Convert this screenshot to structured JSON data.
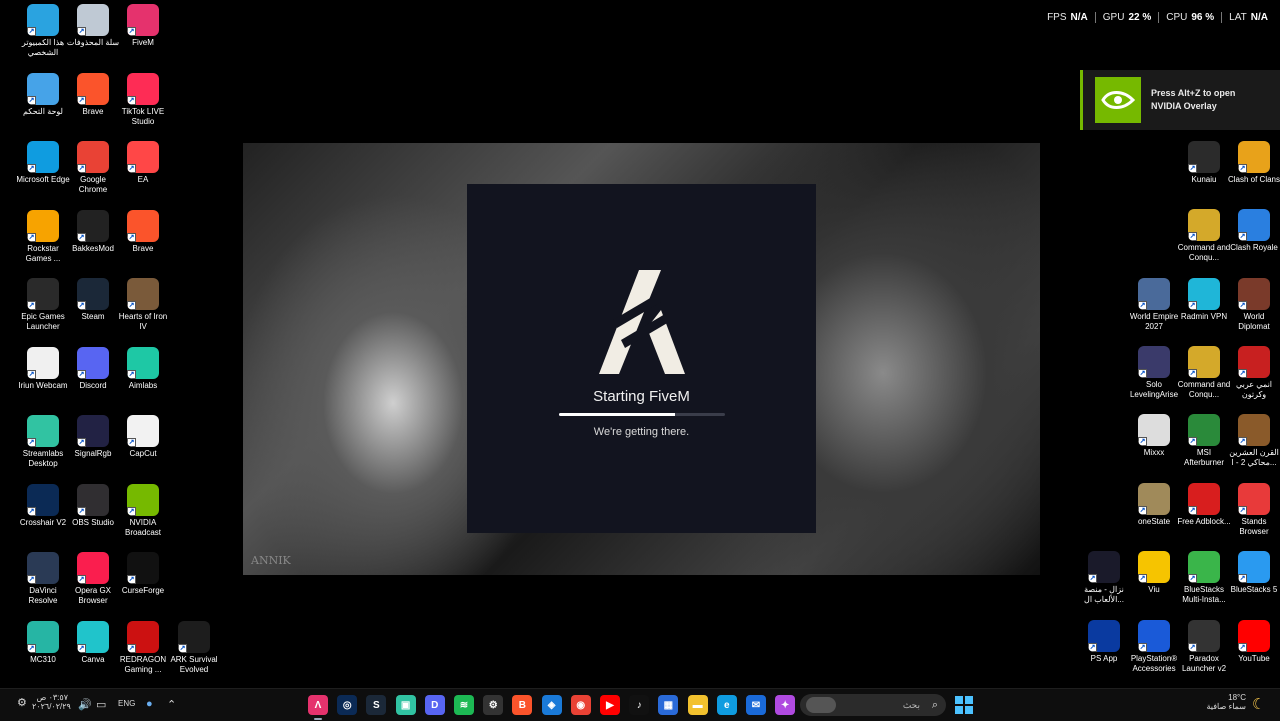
{
  "desktop_left": [
    {
      "label": "هذا الكمبيوتر الشخصي",
      "icon": "monitor-icon",
      "color": "#2aa3e0"
    },
    {
      "label": "سلة المحذوفات",
      "icon": "recycle-bin-icon",
      "color": "#bfc9d4"
    },
    {
      "label": "FiveM",
      "icon": "fivem-icon",
      "color": "#e5326d"
    },
    {
      "label": "لوحة التحكم",
      "icon": "control-panel-icon",
      "color": "#46a3e8"
    },
    {
      "label": "Brave",
      "icon": "brave-icon",
      "color": "#fb542b"
    },
    {
      "label": "TikTok LIVE Studio",
      "icon": "tiktok-icon",
      "color": "#fe2c55"
    },
    {
      "label": "Microsoft Edge",
      "icon": "edge-icon",
      "color": "#0f9ce0"
    },
    {
      "label": "Google Chrome",
      "icon": "chrome-icon",
      "color": "#e94235"
    },
    {
      "label": "EA",
      "icon": "ea-icon",
      "color": "#ff4747"
    },
    {
      "label": "Rockstar Games ...",
      "icon": "rockstar-icon",
      "color": "#f7a300"
    },
    {
      "label": "BakkesMod",
      "icon": "bakkesmod-icon",
      "color": "#222222"
    },
    {
      "label": "Brave",
      "icon": "brave-icon",
      "color": "#fb542b"
    },
    {
      "label": "Epic Games Launcher",
      "icon": "epic-games-icon",
      "color": "#2a2a2a"
    },
    {
      "label": "Steam",
      "icon": "steam-icon",
      "color": "#1b2838"
    },
    {
      "label": "Hearts of Iron IV",
      "icon": "hoi4-icon",
      "color": "#7a5a3a"
    },
    {
      "label": "Iriun Webcam",
      "icon": "webcam-icon",
      "color": "#f0f0f0"
    },
    {
      "label": "Discord",
      "icon": "discord-icon",
      "color": "#5865f2"
    },
    {
      "label": "Aimlabs",
      "icon": "aimlabs-icon",
      "color": "#1ec8a5"
    },
    {
      "label": "Streamlabs Desktop",
      "icon": "streamlabs-icon",
      "color": "#31c3a2"
    },
    {
      "label": "SignalRgb",
      "icon": "signalrgb-icon",
      "color": "#222244"
    },
    {
      "label": "CapCut",
      "icon": "capcut-icon",
      "color": "#f2f2f2"
    },
    {
      "label": "Crosshair V2",
      "icon": "crosshair-icon",
      "color": "#0b2a55"
    },
    {
      "label": "OBS Studio",
      "icon": "obs-icon",
      "color": "#302e31"
    },
    {
      "label": "NVIDIA Broadcast",
      "icon": "nvidia-broadcast-icon",
      "color": "#76b900"
    },
    {
      "label": "DaVinci Resolve",
      "icon": "davinci-icon",
      "color": "#2a3a55"
    },
    {
      "label": "Opera GX Browser",
      "icon": "opera-gx-icon",
      "color": "#fa1e4e"
    },
    {
      "label": "CurseForge",
      "icon": "curseforge-icon",
      "color": "#111111"
    },
    {
      "label": "MC310",
      "icon": "mc310-icon",
      "color": "#26b5a4"
    },
    {
      "label": "Canva",
      "icon": "canva-icon",
      "color": "#20c4cb"
    },
    {
      "label": "REDRAGON Gaming ...",
      "icon": "redragon-icon",
      "color": "#cc1111"
    },
    {
      "label": "ARK Survival Evolved",
      "icon": "ark-icon",
      "color": "#1d1d1d"
    }
  ],
  "desktop_right": [
    {
      "label": "Kunaiu",
      "icon": "kunaiu-icon",
      "color": "#2b2b2b"
    },
    {
      "label": "Clash of Clans",
      "icon": "clash-of-clans-icon",
      "color": "#e8a21a"
    },
    {
      "label": "Command and Conqu...",
      "icon": "command-conquer-icon",
      "color": "#d4a92a"
    },
    {
      "label": "Clash Royale",
      "icon": "clash-royale-icon",
      "color": "#2a7fe0"
    },
    {
      "label": "World Empire 2027",
      "icon": "world-empire-icon",
      "color": "#4a6a9a"
    },
    {
      "label": "Radmin VPN",
      "icon": "radmin-vpn-icon",
      "color": "#1fb6d8"
    },
    {
      "label": "World Diplomat",
      "icon": "world-diplomat-icon",
      "color": "#7a3a2a"
    },
    {
      "label": "Solo LevelingArise",
      "icon": "solo-leveling-icon",
      "color": "#3a3a6a"
    },
    {
      "label": "Command and Conqu...",
      "icon": "command-conquer-icon",
      "color": "#d4a92a"
    },
    {
      "label": "انمي عربي وكرتون",
      "icon": "anime-arabic-icon",
      "color": "#c82020"
    },
    {
      "label": "Mixxx",
      "icon": "mixxx-icon",
      "color": "#dddddd"
    },
    {
      "label": "MSI Afterburner",
      "icon": "msi-afterburner-icon",
      "color": "#2a8a3a"
    },
    {
      "label": "القرن العشرين محاكي 2 - ا...",
      "icon": "game-icon",
      "color": "#8a5a2a"
    },
    {
      "label": "oneState",
      "icon": "onestate-icon",
      "color": "#a08a5a"
    },
    {
      "label": "Free Adblock...",
      "icon": "adblock-icon",
      "color": "#d81e1e"
    },
    {
      "label": "Stands Browser",
      "icon": "stands-icon",
      "color": "#e83a3a"
    },
    {
      "label": "نزال - منصة الألعاب ال...",
      "icon": "nezal-icon",
      "color": "#1a1a2a"
    },
    {
      "label": "Viu",
      "icon": "viu-icon",
      "color": "#f6c400"
    },
    {
      "label": "BlueStacks Multi-Insta...",
      "icon": "bluestacks-icon",
      "color": "#3ab54a"
    },
    {
      "label": "BlueStacks 5",
      "icon": "bluestacks5-icon",
      "color": "#2a9af0"
    },
    {
      "label": "PS App",
      "icon": "ps-app-icon",
      "color": "#0a3aa0"
    },
    {
      "label": "PlayStation® Accessories",
      "icon": "playstation-icon",
      "color": "#1a5ad8"
    },
    {
      "label": "Paradox Launcher v2",
      "icon": "paradox-icon",
      "color": "#333333"
    },
    {
      "label": "YouTube",
      "icon": "youtube-icon",
      "color": "#ff0000"
    }
  ],
  "stats": {
    "fps_label": "FPS",
    "fps_value": "N/A",
    "gpu_label": "GPU",
    "gpu_value": "22 %",
    "cpu_label": "CPU",
    "cpu_value": "96 %",
    "lat_label": "LAT",
    "lat_value": "N/A"
  },
  "nvidia_toast": {
    "text_line1": "Press Alt+Z to open",
    "text_line2": "NVIDIA Overlay",
    "accent": "#76b900"
  },
  "art": {
    "signature": "ANNIK"
  },
  "dialog": {
    "title": "Starting FiveM",
    "subtitle": "We're getting there.",
    "progress": 0.7
  },
  "taskbar": {
    "time": "٠٣:٥٧ ص",
    "date": "٢٠٢٦/٠٢/٢٩",
    "lang": "ENG",
    "search_placeholder": "بحث",
    "weather_temp": "18°C",
    "weather_desc": "سماء صافية",
    "apps": [
      {
        "name": "fivem-taskbar-icon",
        "glyph": "Λ",
        "color": "#e5326d",
        "active": true
      },
      {
        "name": "crosshair-taskbar-icon",
        "glyph": "◎",
        "color": "#0b2a55"
      },
      {
        "name": "steam-taskbar-icon",
        "glyph": "S",
        "color": "#1b2838"
      },
      {
        "name": "streamlabs-taskbar-icon",
        "glyph": "▣",
        "color": "#31c3a2"
      },
      {
        "name": "discord-taskbar-icon",
        "glyph": "D",
        "color": "#5865f2"
      },
      {
        "name": "spotify-taskbar-icon",
        "glyph": "≋",
        "color": "#1db954"
      },
      {
        "name": "settings-taskbar-icon",
        "glyph": "⚙",
        "color": "#333333"
      },
      {
        "name": "brave-taskbar-icon",
        "glyph": "B",
        "color": "#fb542b"
      },
      {
        "name": "remote-taskbar-icon",
        "glyph": "◈",
        "color": "#1a7ad8"
      },
      {
        "name": "chrome-taskbar-icon",
        "glyph": "◉",
        "color": "#e94235"
      },
      {
        "name": "youtube-taskbar-icon",
        "glyph": "▶",
        "color": "#ff0000"
      },
      {
        "name": "tiktok-taskbar-icon",
        "glyph": "♪",
        "color": "#111111"
      },
      {
        "name": "store-taskbar-icon",
        "glyph": "▦",
        "color": "#2a6ad8"
      },
      {
        "name": "file-explorer-taskbar-icon",
        "glyph": "▬",
        "color": "#f2c12e"
      },
      {
        "name": "edge-taskbar-icon",
        "glyph": "e",
        "color": "#0f9ce0"
      },
      {
        "name": "mail-taskbar-icon",
        "glyph": "✉",
        "color": "#1a6ad8"
      },
      {
        "name": "copilot-taskbar-icon",
        "glyph": "✦",
        "color": "#b04ae0"
      }
    ]
  }
}
